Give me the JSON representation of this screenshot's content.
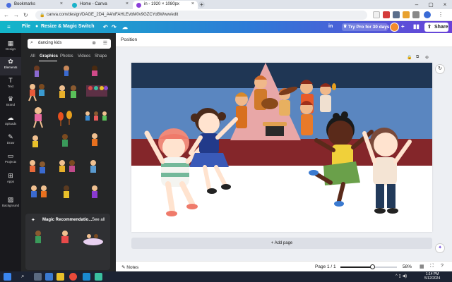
{
  "browser": {
    "tabs": [
      {
        "label": "Bookmarks",
        "color": "#4a6ee0"
      },
      {
        "label": "Home - Canva",
        "color": "#19b2c9"
      },
      {
        "label": "in - 1920 × 1080px",
        "color": "#8b3fd9",
        "active": true
      }
    ],
    "url": "canva.com/design/DAGE_2D4_A4/oFAHLEvbM0v9GZCYoBWww/edit"
  },
  "header": {
    "file_label": "File",
    "resize_label": "Resize & Magic Switch",
    "in_label": "in",
    "try_pro_label": "Try Pro for 30 days",
    "share_label": "Share"
  },
  "rail": {
    "items": [
      {
        "label": "Design",
        "icon": "▦"
      },
      {
        "label": "Elements",
        "icon": "✿"
      },
      {
        "label": "Text",
        "icon": "T"
      },
      {
        "label": "Brand",
        "icon": "♛"
      },
      {
        "label": "Uploads",
        "icon": "☁"
      },
      {
        "label": "Draw",
        "icon": "✎"
      },
      {
        "label": "Projects",
        "icon": "▭"
      },
      {
        "label": "Apps",
        "icon": "⊞"
      },
      {
        "label": "Background",
        "icon": "▨"
      }
    ]
  },
  "panel": {
    "search_value": "dancing kids",
    "filter_tabs": [
      "All",
      "Graphics",
      "Photos",
      "Videos",
      "Shape"
    ],
    "magic_title": "Magic Recommendatio...",
    "see_all": "See all"
  },
  "workspace": {
    "position_label": "Position",
    "add_page_label": "+ Add page",
    "notes_label": "Notes",
    "page_label": "Page 1 / 1",
    "zoom_label": "58%",
    "zoom_fraction": 0.58
  },
  "taskbar": {
    "time": "1:14 PM",
    "date": "5/12/2024"
  },
  "colors": {
    "canva_header_start": "#13b6c9",
    "canva_header_end": "#6a42d8",
    "panel_bg": "#252627",
    "rail_bg": "#19191d",
    "canvas_stripe_navy": "#1f3654",
    "canvas_stripe_blue": "#5a86c0",
    "canvas_stripe_maroon": "#84262a"
  }
}
